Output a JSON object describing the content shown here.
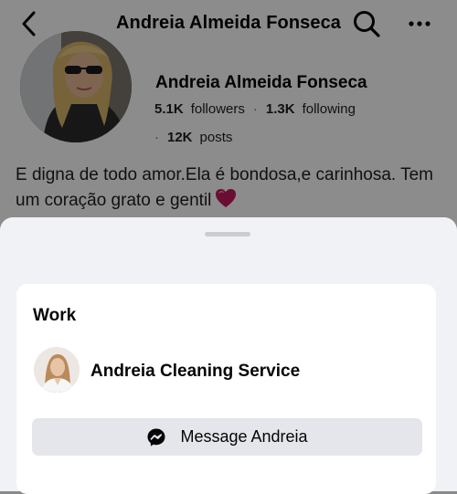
{
  "header": {
    "title": "Andreia Almeida Fonseca",
    "back_icon": "chevron-left-icon",
    "search_icon": "search-icon",
    "more_icon": "more-horizontal-icon"
  },
  "profile": {
    "name": "Andreia Almeida Fonseca",
    "followers_count": "5.1K",
    "followers_label": "followers",
    "separator": "·",
    "following_count": "1.3K",
    "following_label": "following",
    "posts_count": "12K",
    "posts_label": "posts",
    "bio": "E digna de todo amor.Ela é bondosa,e carinhosa. Tem um coração grato e gentil",
    "bio_emoji_icon": "purple-heart-icon"
  },
  "sheet": {
    "section_title": "Work",
    "workplace_name": "Andreia Cleaning Service",
    "message_button_label": "Message Andreia",
    "message_button_icon": "messenger-icon"
  },
  "colors": {
    "sheet_background": "#f0f2f5",
    "card_background": "#ffffff",
    "button_background": "#e4e6eb",
    "heart": "#c2185b"
  }
}
